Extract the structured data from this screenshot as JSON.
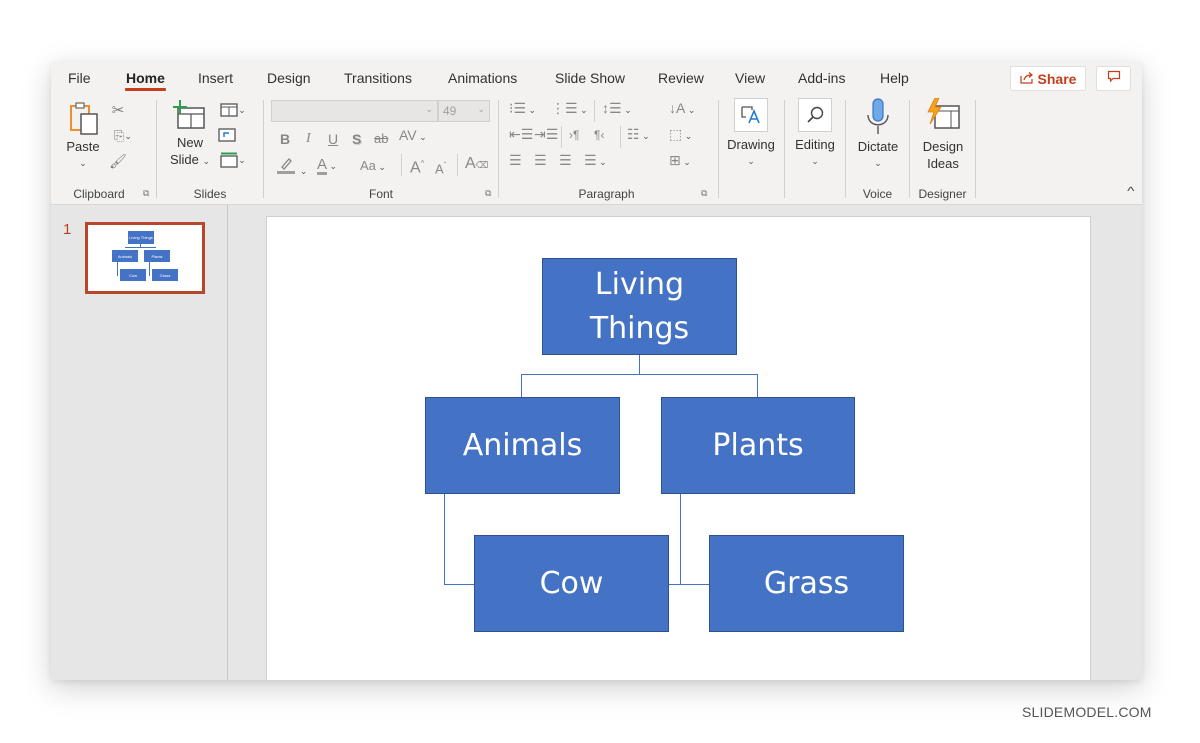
{
  "menu": {
    "tabs": [
      {
        "label": "File"
      },
      {
        "label": "Home",
        "active": true
      },
      {
        "label": "Insert"
      },
      {
        "label": "Design"
      },
      {
        "label": "Transitions"
      },
      {
        "label": "Animations"
      },
      {
        "label": "Slide Show"
      },
      {
        "label": "Review"
      },
      {
        "label": "View"
      },
      {
        "label": "Add-ins"
      },
      {
        "label": "Help"
      }
    ],
    "share_label": "Share",
    "share_icon": "share-icon",
    "comment_icon": "comment-icon"
  },
  "ribbon": {
    "clipboard": {
      "label": "Clipboard",
      "paste_label": "Paste",
      "icons": [
        "paste-icon",
        "cut-icon",
        "copy-icon",
        "format-painter-icon"
      ]
    },
    "slides": {
      "label": "Slides",
      "new_slide_line1": "New",
      "new_slide_line2": "Slide",
      "icons": [
        "new-slide-icon",
        "layout-icon",
        "reset-icon",
        "section-icon"
      ]
    },
    "font": {
      "label": "Font",
      "font_name_value": "",
      "font_size_value": "49",
      "buttons": {
        "bold": "B",
        "italic": "I",
        "underline": "U",
        "shadow": "S",
        "strikethrough": "ab",
        "spacing": "AV",
        "change_case": "Aa",
        "grow": "A",
        "shrink": "A",
        "font_color": "A"
      }
    },
    "paragraph": {
      "label": "Paragraph"
    },
    "drawing": {
      "label": "Drawing"
    },
    "editing": {
      "label": "Editing"
    },
    "voice": {
      "label": "Voice",
      "dictate_label": "Dictate"
    },
    "designer": {
      "label": "Designer",
      "design_ideas_line1": "Design",
      "design_ideas_line2": "Ideas"
    }
  },
  "thumbnails": {
    "slides": [
      {
        "number": "1",
        "selected": true
      }
    ]
  },
  "diagram": {
    "root": {
      "line1": "Living",
      "line2": "Things"
    },
    "children": [
      {
        "label": "Animals",
        "child": "Cow"
      },
      {
        "label": "Plants",
        "child": "Grass"
      }
    ],
    "color": "#4472c4"
  },
  "watermark": "SLIDEMODEL.COM"
}
